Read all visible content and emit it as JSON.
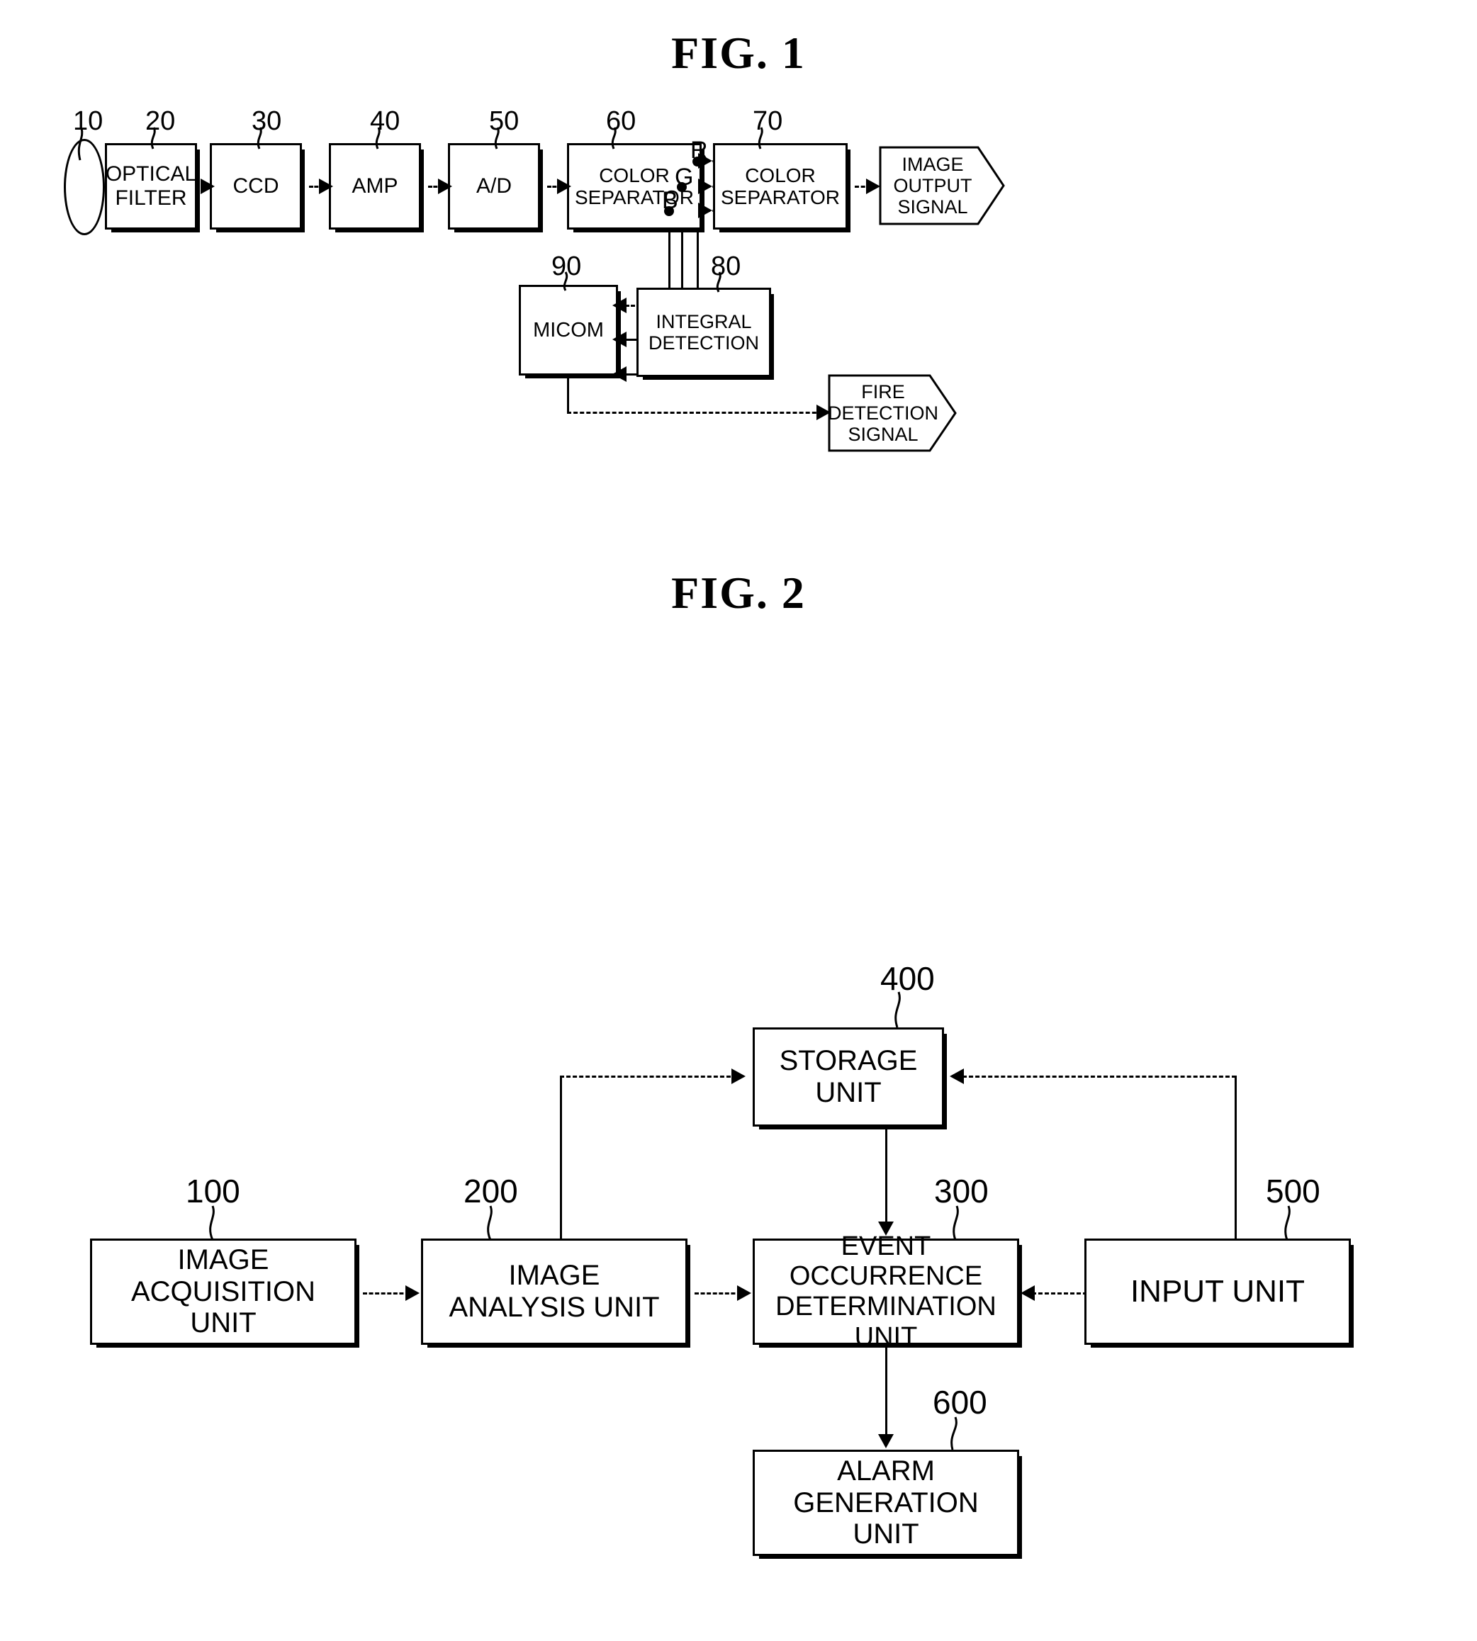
{
  "figures": [
    {
      "title": "FIG. 1",
      "blocks": [
        {
          "ref": "10",
          "label": "",
          "shape": "lens"
        },
        {
          "ref": "20",
          "label": "OPTICAL\nFILTER",
          "shape": "box"
        },
        {
          "ref": "30",
          "label": "CCD",
          "shape": "box"
        },
        {
          "ref": "40",
          "label": "AMP",
          "shape": "box"
        },
        {
          "ref": "50",
          "label": "A/D",
          "shape": "box"
        },
        {
          "ref": "60",
          "label": "COLOR\nSEPARATOR",
          "shape": "box"
        },
        {
          "ref": "70",
          "label": "COLOR\nSEPARATOR",
          "shape": "box"
        },
        {
          "ref": "",
          "label": "IMAGE\nOUTPUT\nSIGNAL",
          "shape": "flag"
        },
        {
          "ref": "80",
          "label": "INTEGRAL\nDETECTION",
          "shape": "box"
        },
        {
          "ref": "90",
          "label": "MICOM",
          "shape": "box"
        },
        {
          "ref": "",
          "label": "FIRE\nDETECTION\nSIGNAL",
          "shape": "flag"
        }
      ],
      "signal_labels": [
        "R",
        "G",
        "B"
      ]
    },
    {
      "title": "FIG. 2",
      "blocks": [
        {
          "ref": "100",
          "label": "IMAGE\nACQUISITION UNIT",
          "shape": "box"
        },
        {
          "ref": "200",
          "label": "IMAGE\nANALYSIS UNIT",
          "shape": "box"
        },
        {
          "ref": "300",
          "label": "EVENT OCCURRENCE\nDETERMINATION UNIT",
          "shape": "box"
        },
        {
          "ref": "400",
          "label": "STORAGE\nUNIT",
          "shape": "box"
        },
        {
          "ref": "500",
          "label": "INPUT UNIT",
          "shape": "box"
        },
        {
          "ref": "600",
          "label": "ALARM\nGENERATION UNIT",
          "shape": "box"
        }
      ]
    }
  ],
  "fig1": {
    "title": "FIG. 1",
    "lens_ref": "10",
    "optical_filter": {
      "ref": "20",
      "label": "OPTICAL\nFILTER"
    },
    "ccd": {
      "ref": "30",
      "label": "CCD"
    },
    "amp": {
      "ref": "40",
      "label": "AMP"
    },
    "ad": {
      "ref": "50",
      "label": "A/D"
    },
    "color_separator_1": {
      "ref": "60",
      "label": "COLOR\nSEPARATOR"
    },
    "color_separator_2": {
      "ref": "70",
      "label": "COLOR\nSEPARATOR"
    },
    "image_output_signal": {
      "label": "IMAGE\nOUTPUT\nSIGNAL"
    },
    "integral_detection": {
      "ref": "80",
      "label": "INTEGRAL\nDETECTION"
    },
    "micom": {
      "ref": "90",
      "label": "MICOM"
    },
    "fire_detection_signal": {
      "label": "FIRE\nDETECTION\nSIGNAL"
    },
    "r_label": "R",
    "g_label": "G",
    "b_label": "B"
  },
  "fig2": {
    "title": "FIG. 2",
    "image_acquisition_unit": {
      "ref": "100",
      "label": "IMAGE\nACQUISITION UNIT"
    },
    "image_analysis_unit": {
      "ref": "200",
      "label": "IMAGE\nANALYSIS UNIT"
    },
    "event_occurrence_determination_unit": {
      "ref": "300",
      "label": "EVENT OCCURRENCE\nDETERMINATION UNIT"
    },
    "storage_unit": {
      "ref": "400",
      "label": "STORAGE\nUNIT"
    },
    "input_unit": {
      "ref": "500",
      "label": "INPUT UNIT"
    },
    "alarm_generation_unit": {
      "ref": "600",
      "label": "ALARM\nGENERATION UNIT"
    }
  },
  "colors": {
    "ink": "#000000",
    "paper": "#ffffff"
  }
}
